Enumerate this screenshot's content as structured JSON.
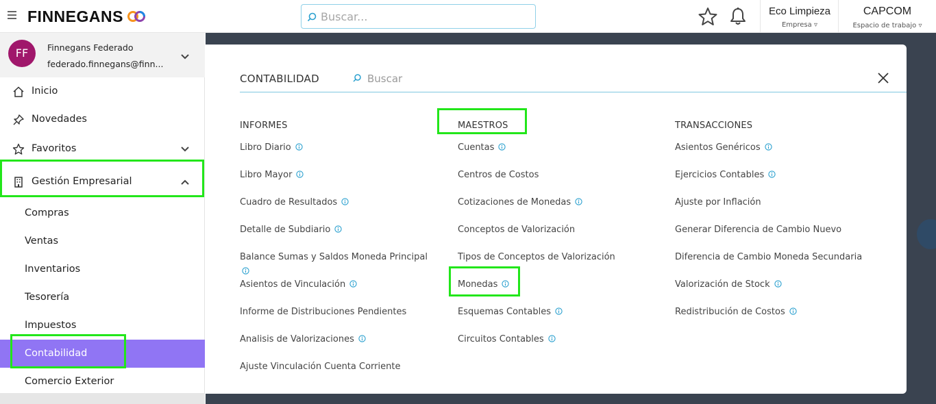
{
  "header": {
    "logo_text": "FINNEGANS",
    "search_placeholder": "Buscar...",
    "company_name": "Eco Limpieza",
    "company_label": "Empresa",
    "workspace_name": "CAPCOM",
    "workspace_label": "Espacio de trabajo",
    "brand_colors": {
      "orange": "#f7941d",
      "blue": "#1e88e5",
      "purple": "#8e44ad"
    }
  },
  "user": {
    "initials": "FF",
    "name": "Finnegans Federado",
    "email": "federado.finnegans@finn..."
  },
  "sidebar": {
    "items": [
      {
        "label": "Inicio",
        "icon": "home-icon"
      },
      {
        "label": "Novedades",
        "icon": "pin-icon"
      },
      {
        "label": "Favoritos",
        "icon": "star-icon"
      },
      {
        "label": "Gestión Empresarial",
        "icon": "building-icon"
      }
    ],
    "sub_items": [
      {
        "label": "Compras"
      },
      {
        "label": "Ventas"
      },
      {
        "label": "Inventarios"
      },
      {
        "label": "Tesorería"
      },
      {
        "label": "Impuestos"
      },
      {
        "label": "Contabilidad"
      },
      {
        "label": "Comercio Exterior"
      }
    ],
    "active_color": "#9075f4"
  },
  "panel": {
    "title": "CONTABILIDAD",
    "search_placeholder": "Buscar",
    "columns": [
      {
        "heading": "INFORMES",
        "links": [
          {
            "label": "Libro Diario",
            "info": true
          },
          {
            "label": "Libro Mayor",
            "info": true
          },
          {
            "label": "Cuadro de Resultados",
            "info": true
          },
          {
            "label": "Detalle de Subdiario",
            "info": true
          },
          {
            "label": "Balance Sumas y Saldos Moneda Principal",
            "info": true
          },
          {
            "label": "Asientos de Vinculación",
            "info": true
          },
          {
            "label": "Informe de Distribuciones Pendientes",
            "info": false
          },
          {
            "label": "Analisis de Valorizaciones",
            "info": true
          },
          {
            "label": "Ajuste Vinculación Cuenta Corriente",
            "info": false
          }
        ]
      },
      {
        "heading": "MAESTROS",
        "links": [
          {
            "label": "Cuentas",
            "info": true
          },
          {
            "label": "Centros de Costos",
            "info": false
          },
          {
            "label": "Cotizaciones de Monedas",
            "info": true
          },
          {
            "label": "Conceptos de Valorización",
            "info": false
          },
          {
            "label": "Tipos de Conceptos de Valorización",
            "info": false
          },
          {
            "label": "Monedas",
            "info": true
          },
          {
            "label": "Esquemas Contables",
            "info": true
          },
          {
            "label": "Circuitos Contables",
            "info": true
          }
        ]
      },
      {
        "heading": "TRANSACCIONES",
        "links": [
          {
            "label": "Asientos Genéricos",
            "info": true
          },
          {
            "label": "Ejercicios Contables",
            "info": true
          },
          {
            "label": "Ajuste por Inflación",
            "info": false
          },
          {
            "label": "Generar Diferencia de Cambio Nuevo",
            "info": false
          },
          {
            "label": "Diferencia de Cambio Moneda Secundaria",
            "info": false
          },
          {
            "label": "Valorización de Stock",
            "info": true
          },
          {
            "label": "Redistribución de Costos",
            "info": true
          }
        ]
      }
    ]
  },
  "highlight_color": "#22e61a"
}
